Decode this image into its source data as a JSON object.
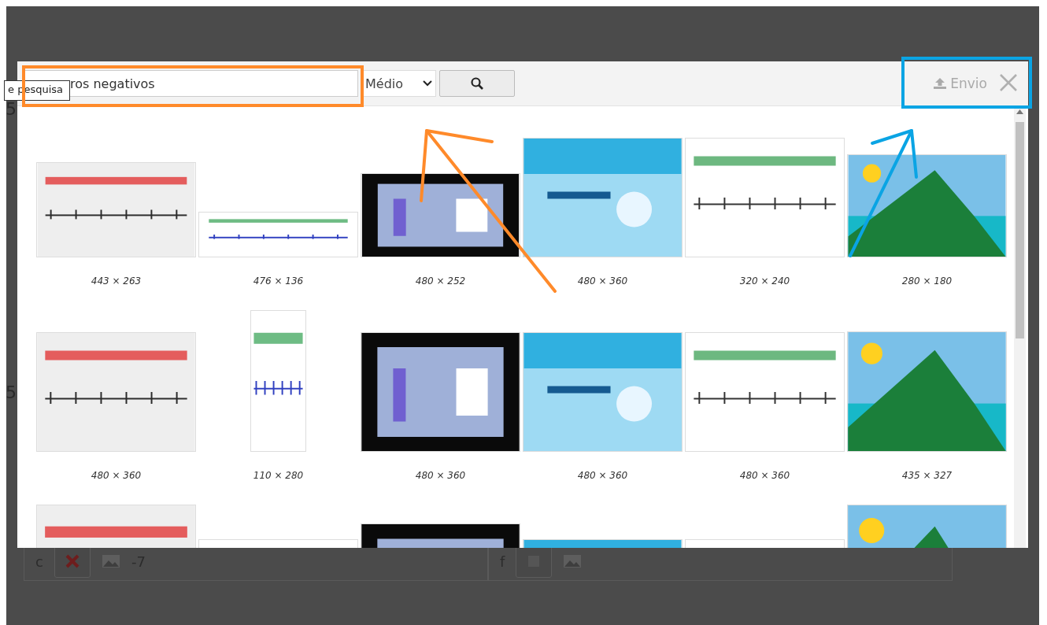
{
  "background_page": {
    "side_numbers": [
      "5",
      "5"
    ],
    "answer_rows": [
      {
        "letter": "c",
        "value": "-7",
        "marked_wrong": true
      },
      {
        "letter": "f",
        "marked_wrong": false
      }
    ]
  },
  "dialog": {
    "search": {
      "label": "e pesquisa",
      "value": "ros negativos"
    },
    "size_select": {
      "value": "Médio"
    },
    "upload_button": {
      "label": "Envio",
      "disabled": true
    },
    "results": [
      {
        "kind": "picture",
        "caption": "443 × 263"
      },
      {
        "kind": "picture",
        "caption": "476 × 136"
      },
      {
        "kind": "picture",
        "caption": "480 × 252"
      },
      {
        "kind": "picture",
        "caption": "480 × 360"
      },
      {
        "kind": "picture",
        "caption": "320 × 240"
      },
      {
        "kind": "picture",
        "caption": "280 × 180"
      },
      {
        "kind": "picture",
        "caption": "480 × 360"
      },
      {
        "kind": "picture",
        "caption": "110 × 280"
      },
      {
        "kind": "picture",
        "caption": "480 × 360"
      },
      {
        "kind": "picture",
        "caption": "480 × 360"
      },
      {
        "kind": "picture",
        "caption": "480 × 360"
      },
      {
        "kind": "picture",
        "caption": "435 × 327"
      },
      {
        "kind": "picture"
      },
      {
        "kind": "picture"
      },
      {
        "kind": "picture"
      },
      {
        "kind": "picture"
      },
      {
        "kind": "picture"
      },
      {
        "kind": "picture"
      }
    ]
  },
  "annotations": [
    {
      "kind": "box",
      "color": "#ff8a2a"
    },
    {
      "kind": "arrow",
      "color": "#ff8a2a"
    },
    {
      "kind": "box",
      "color": "#0aa4e4"
    },
    {
      "kind": "arrow",
      "color": "#0aa4e4"
    }
  ]
}
